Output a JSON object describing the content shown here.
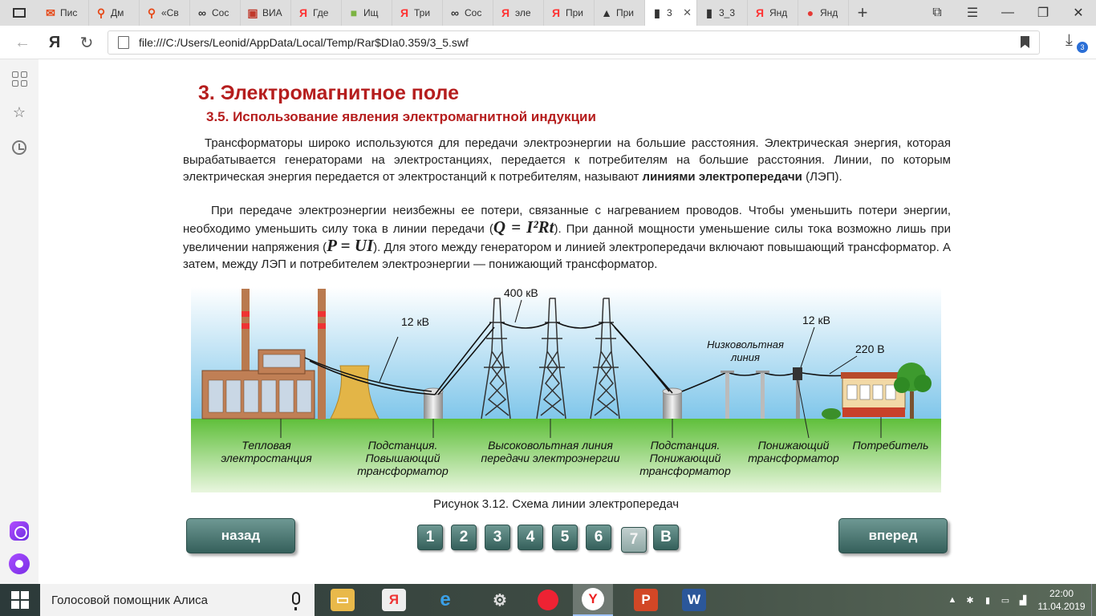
{
  "tabs": [
    {
      "label": "Пис",
      "icon": "mail-icon",
      "color": "#e64a19"
    },
    {
      "label": "Дм",
      "icon": "pin-icon",
      "color": "#e64a19"
    },
    {
      "label": "«Св",
      "icon": "pin-icon",
      "color": "#e64a19"
    },
    {
      "label": "Сос",
      "icon": "glasses-icon",
      "color": "#333333"
    },
    {
      "label": "ВИА",
      "icon": "box-icon",
      "color": "#c0392b"
    },
    {
      "label": "Где",
      "icon": "yandex-icon",
      "color": "#ff3333"
    },
    {
      "label": "Ищ",
      "icon": "square-icon",
      "color": "#7cb342"
    },
    {
      "label": "Три",
      "icon": "yandex-icon",
      "color": "#ff3333"
    },
    {
      "label": "Сос",
      "icon": "glasses-icon",
      "color": "#333333"
    },
    {
      "label": "эле",
      "icon": "yandex-icon",
      "color": "#ff3333"
    },
    {
      "label": "При",
      "icon": "yandex-icon",
      "color": "#ff3333"
    },
    {
      "label": "При",
      "icon": "mountain-icon",
      "color": "#333333"
    },
    {
      "label": "3",
      "icon": "doc-icon",
      "color": "#333333",
      "active": true
    },
    {
      "label": "3_3",
      "icon": "doc-icon",
      "color": "#333333"
    },
    {
      "label": "Янд",
      "icon": "yandex-icon",
      "color": "#ff3333"
    },
    {
      "label": "Янд",
      "icon": "yandex-circle-icon",
      "color": "#e53935"
    }
  ],
  "address": {
    "url": "file:///C:/Users/Leonid/AppData/Local/Temp/Rar$DIa0.359/3_5.swf",
    "browser_logo": "Я",
    "downloads_count": "3"
  },
  "page": {
    "title": "3. Электромагнитное поле",
    "subtitle": "3.5. Использование явления электромагнитной индукции",
    "p1_a": "Трансформаторы широко используются для передачи электроэнергии на большие расстояния. Электрическая энергия, которая вырабатывается генераторами на электростанциях, передается к потребителям на большие расстояния. Линии, по которым электрическая энергия передается от электростанций к потребителям, называют ",
    "p1_bold": "линиями электропередачи",
    "p1_b": " (ЛЭП).",
    "p2_a": "При передаче электроэнергии неизбежны ее потери, связанные с нагреванием проводов. Чтобы уменьшить потери энергии, необходимо уменьшить силу тока в линии передачи (",
    "formula1": "Q = I²Rt",
    "p2_b": "). При данной мощности уменьшение силы тока возможно лишь при увеличении напряжения (",
    "formula2": "P = UI",
    "p2_c": "). Для этого между генератором и линией электропередачи включают повышающий трансформатор. А затем, между ЛЭП и потребителем электроэнергии — понижающий трансформатор.",
    "caption": "Рисунок 3.12. Схема линии электропередач"
  },
  "diagram": {
    "v_400": "400 кВ",
    "v_12_left": "12 кВ",
    "v_12_right": "12 кВ",
    "v_220": "220 В",
    "low_line_1": "Низковольтная",
    "low_line_2": "линия",
    "labels": {
      "plant_1": "Тепловая",
      "plant_2": "электростанция",
      "sub1_1": "Подстанция.",
      "sub1_2": "Повышающий",
      "sub1_3": "трансформатор",
      "hv_1": "Высоковольтная линия",
      "hv_2": "передачи электроэнергии",
      "sub2_1": "Подстанция.",
      "sub2_2": "Понижающий",
      "sub2_3": "трансформатор",
      "down_1": "Понижающий",
      "down_2": "трансформатор",
      "consumer": "Потребитель"
    }
  },
  "nav": {
    "back": "назад",
    "forward": "вперед",
    "pages": [
      "1",
      "2",
      "3",
      "4",
      "5",
      "6",
      "7",
      "B"
    ],
    "current_page": "7"
  },
  "taskbar": {
    "search_text": "Голосовой помощник Алиса",
    "time": "22:00",
    "date": "11.04.2019"
  }
}
